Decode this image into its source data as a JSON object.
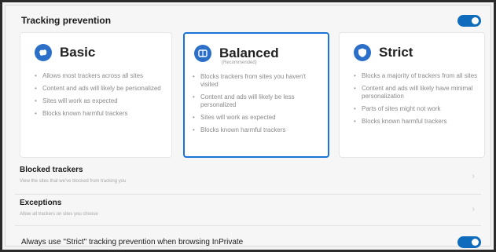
{
  "header": {
    "title": "Tracking prevention",
    "toggle_on": true
  },
  "cards": [
    {
      "title": "Basic",
      "subtitle": "",
      "icon": "basic-icon",
      "bullets": [
        "Allows most trackers across all sites",
        "Content and ads will likely be personalized",
        "Sites will work as expected",
        "Blocks known harmful trackers"
      ]
    },
    {
      "title": "Balanced",
      "subtitle": "(Recommended)",
      "icon": "balanced-icon",
      "selected": true,
      "bullets": [
        "Blocks trackers from sites you haven't visited",
        "Content and ads will likely be less personalized",
        "Sites will work as expected",
        "Blocks known harmful trackers"
      ]
    },
    {
      "title": "Strict",
      "subtitle": "",
      "icon": "shield-icon",
      "bullets": [
        "Blocks a majority of trackers from all sites",
        "Content and ads will likely have minimal personalization",
        "Parts of sites might not work",
        "Blocks known harmful trackers"
      ]
    }
  ],
  "rows": [
    {
      "title": "Blocked trackers",
      "description": "View the sites that we've blocked from tracking you"
    },
    {
      "title": "Exceptions",
      "description": "Allow all trackers on sites you choose"
    }
  ],
  "bottom": {
    "label": "Always use \"Strict\" tracking prevention when browsing InPrivate",
    "toggle_on": true
  },
  "colors": {
    "accent": "#0f6cbd",
    "selected_border": "#1a73d6"
  }
}
